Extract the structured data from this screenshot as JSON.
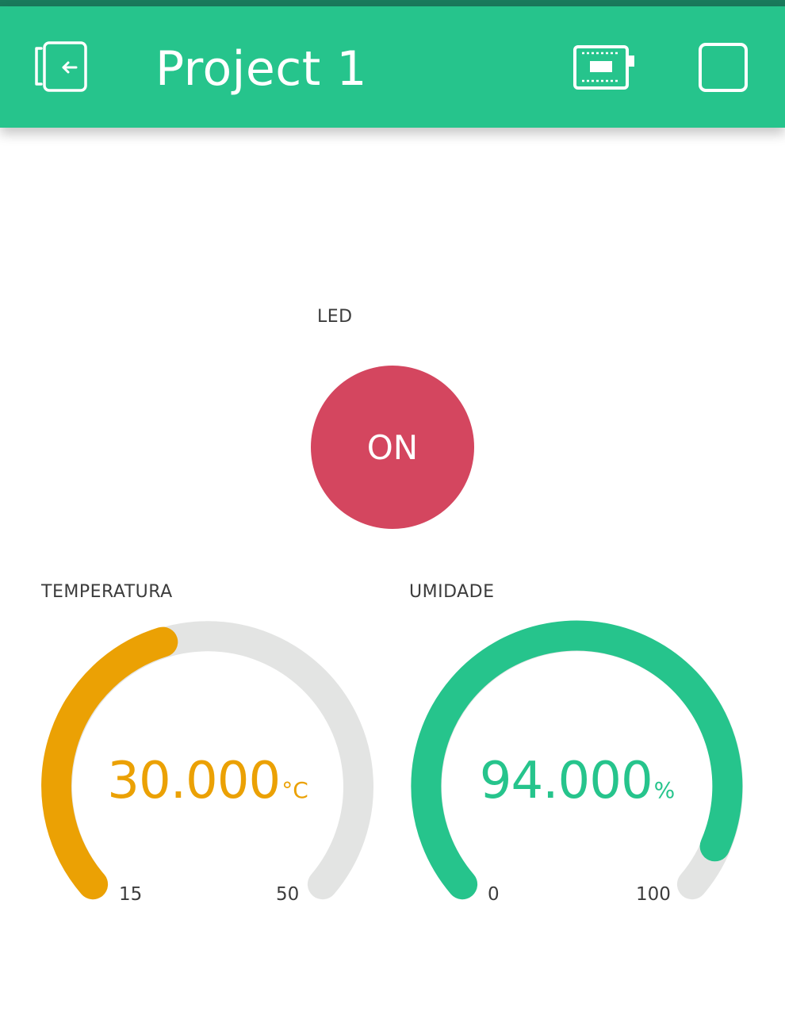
{
  "header": {
    "title": "Project 1",
    "icons": [
      "exit-icon",
      "device-icon",
      "square-icon"
    ]
  },
  "colors": {
    "header_bg": "#26c48c",
    "led_button": "#d4465f",
    "temperature_accent": "#eba104",
    "humidity_accent": "#26c48c",
    "gauge_track": "#e3e4e3"
  },
  "led": {
    "label": "LED",
    "button_text": "ON"
  },
  "temperature": {
    "label": "TEMPERATURA",
    "value": "30.000",
    "unit": "°C",
    "min": "15",
    "max": "50"
  },
  "humidity": {
    "label": "UMIDADE",
    "value": "94.000",
    "unit": "%",
    "min": "0",
    "max": "100"
  }
}
